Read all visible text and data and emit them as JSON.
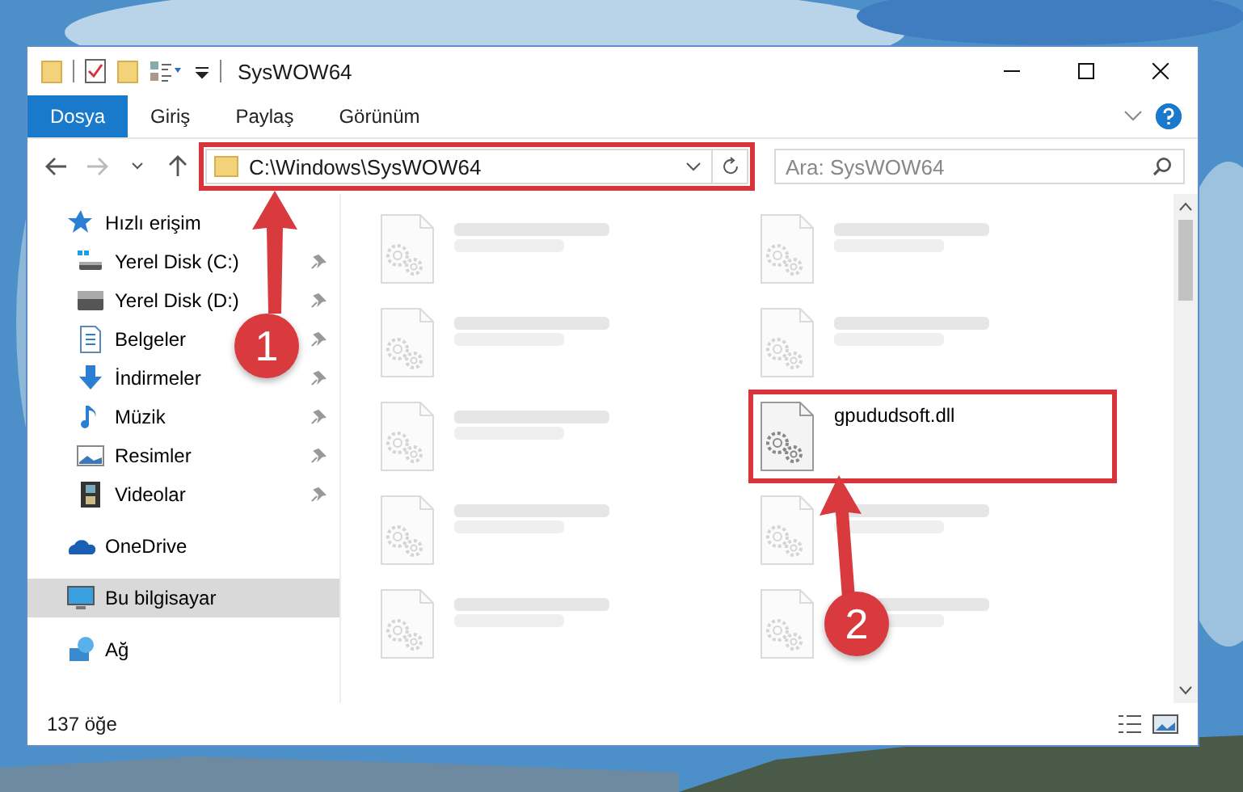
{
  "window": {
    "title": "SysWOW64"
  },
  "ribbon_tabs": [
    {
      "label": "Dosya",
      "selected": true
    },
    {
      "label": "Giriş",
      "selected": false
    },
    {
      "label": "Paylaş",
      "selected": false
    },
    {
      "label": "Görünüm",
      "selected": false
    }
  ],
  "address_bar": {
    "path": "C:\\Windows\\SysWOW64",
    "highlighted": true
  },
  "search": {
    "placeholder": "Ara: SysWOW64"
  },
  "sidebar": {
    "items": [
      {
        "label": "Hızlı erişim",
        "kind": "star",
        "selected": false,
        "children": [
          {
            "label": "Yerel Disk (C:)",
            "kind": "windrive",
            "pinned": true,
            "selected": false
          },
          {
            "label": "Yerel Disk (D:)",
            "kind": "drive",
            "pinned": true,
            "selected": false
          },
          {
            "label": "Belgeler",
            "kind": "document",
            "pinned": true,
            "selected": false
          },
          {
            "label": "İndirmeler",
            "kind": "download",
            "pinned": true,
            "selected": false
          },
          {
            "label": "Müzik",
            "kind": "music",
            "pinned": true,
            "selected": false
          },
          {
            "label": "Resimler",
            "kind": "pictures",
            "pinned": true,
            "selected": false
          },
          {
            "label": "Videolar",
            "kind": "video",
            "pinned": true,
            "selected": false
          }
        ]
      },
      {
        "label": "OneDrive",
        "kind": "cloud",
        "selected": false
      },
      {
        "label": "Bu bilgisayar",
        "kind": "computer",
        "selected": true
      },
      {
        "label": "Ağ",
        "kind": "network",
        "selected": false
      }
    ]
  },
  "files": [
    {
      "blurred": true,
      "highlighted": false
    },
    {
      "blurred": true,
      "highlighted": false
    },
    {
      "blurred": true,
      "highlighted": false
    },
    {
      "blurred": true,
      "highlighted": false
    },
    {
      "blurred": true,
      "highlighted": false
    },
    {
      "name": "gpududsoft.dll",
      "blurred": false,
      "highlighted": true
    },
    {
      "blurred": true,
      "highlighted": false
    },
    {
      "blurred": true,
      "highlighted": false
    },
    {
      "blurred": true,
      "highlighted": false
    },
    {
      "blurred": true,
      "highlighted": false
    }
  ],
  "status_bar": {
    "count": "137 öğe"
  },
  "annotations": [
    {
      "label": "1"
    },
    {
      "label": "2"
    }
  ]
}
